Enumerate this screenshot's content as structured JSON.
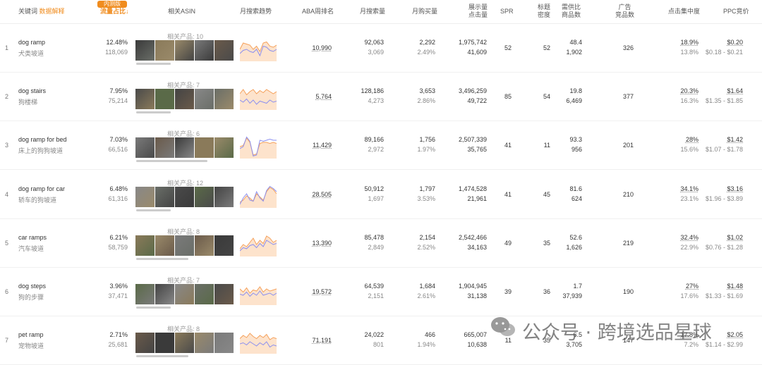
{
  "headers": {
    "keyword": "关键词",
    "explain": "数据解释",
    "traffic_share": "流量占比",
    "traffic_badge": "内测版",
    "related_asin": "相关ASIN",
    "monthly_trend": "月搜索趋势",
    "aba_rank": "ABA周排名",
    "monthly_search": "月搜索量",
    "monthly_purchase": "月购买量",
    "impressions_clicks": [
      "展示量",
      "点击量"
    ],
    "spr": "SPR",
    "title_density": [
      "标题",
      "密度"
    ],
    "supply_demand": [
      "需供比",
      "商品数"
    ],
    "ads": [
      "广告",
      "竞品数"
    ],
    "click_concentration": "点击集中度",
    "ppc": "PPC竞价"
  },
  "rows": [
    {
      "idx": "1",
      "keyword": "dog ramp",
      "keyword_cn": "犬类坡道",
      "share_pct": "12.48%",
      "share_num": "118,069",
      "related": "相关产品: 10",
      "bar_frac": 0.38,
      "aba": "10,990",
      "search": "92,063",
      "search_sub": "3,069",
      "purchase": "2,292",
      "purchase_rate": "2.49%",
      "impressions": "1,975,742",
      "clicks": "41,609",
      "spr": "52",
      "title_density": "52",
      "ratio": "48.4",
      "products": "1,902",
      "ads": "326",
      "click_conc": "18.9%",
      "click_conc_sub": "13.8%",
      "ppc": "$0.20",
      "ppc_range": "$0.18 - $0.21",
      "trend": {
        "orange": [
          0.5,
          0.2,
          0.25,
          0.3,
          0.5,
          0.35,
          0.6,
          0.2,
          0.15,
          0.35,
          0.4,
          0.3
        ],
        "blue": [
          0.7,
          0.55,
          0.5,
          0.6,
          0.65,
          0.5,
          0.8,
          0.35,
          0.4,
          0.55,
          0.6,
          0.5
        ]
      }
    },
    {
      "idx": "2",
      "keyword": "dog stairs",
      "keyword_cn": "狗楼梯",
      "share_pct": "7.95%",
      "share_num": "75,214",
      "related": "相关产品: 7",
      "bar_frac": 0.38,
      "aba": "5,764",
      "search": "128,186",
      "search_sub": "4,273",
      "purchase": "3,653",
      "purchase_rate": "2.86%",
      "impressions": "3,496,259",
      "clicks": "49,722",
      "spr": "85",
      "title_density": "54",
      "ratio": "19.8",
      "products": "6,469",
      "ads": "377",
      "click_conc": "20.3%",
      "click_conc_sub": "16.3%",
      "ppc": "$1.64",
      "ppc_range": "$1.35 - $1.85",
      "trend": {
        "orange": [
          0.3,
          0.1,
          0.35,
          0.2,
          0.1,
          0.3,
          0.15,
          0.25,
          0.1,
          0.2,
          0.3,
          0.2
        ],
        "blue": [
          0.6,
          0.7,
          0.55,
          0.75,
          0.6,
          0.8,
          0.65,
          0.7,
          0.75,
          0.6,
          0.7,
          0.65
        ]
      }
    },
    {
      "idx": "3",
      "keyword": "dog ramp for bed",
      "keyword_cn": "床上的狗狗坡道",
      "share_pct": "7.03%",
      "share_num": "66,516",
      "related": "相关产品: 6",
      "bar_frac": 0.78,
      "aba": "11,429",
      "search": "89,166",
      "search_sub": "2,972",
      "purchase": "1,756",
      "purchase_rate": "1.97%",
      "impressions": "2,507,339",
      "clicks": "35,765",
      "spr": "41",
      "title_density": "11",
      "ratio": "93.3",
      "products": "956",
      "ads": "201",
      "click_conc": "28%",
      "click_conc_sub": "15.6%",
      "ppc": "$1.42",
      "ppc_range": "$1.07 - $1.78",
      "trend": {
        "orange": [
          0.5,
          0.45,
          0.1,
          0.3,
          0.9,
          0.85,
          0.35,
          0.3,
          0.3,
          0.35,
          0.3,
          0.35
        ],
        "blue": [
          0.6,
          0.5,
          0.05,
          0.25,
          0.95,
          0.9,
          0.2,
          0.25,
          0.2,
          0.15,
          0.2,
          0.2
        ]
      }
    },
    {
      "idx": "4",
      "keyword": "dog ramp for car",
      "keyword_cn": "轿车的狗坡道",
      "share_pct": "6.48%",
      "share_num": "61,316",
      "related": "相关产品: 12",
      "bar_frac": 0.38,
      "aba": "28,505",
      "search": "50,912",
      "search_sub": "1,697",
      "purchase": "1,797",
      "purchase_rate": "3.53%",
      "impressions": "1,474,528",
      "clicks": "21,961",
      "spr": "41",
      "title_density": "45",
      "ratio": "81.6",
      "products": "624",
      "ads": "210",
      "click_conc": "34.1%",
      "click_conc_sub": "23.1%",
      "ppc": "$3.16",
      "ppc_range": "$1.96 - $3.89",
      "trend": {
        "orange": [
          0.8,
          0.7,
          0.5,
          0.6,
          0.75,
          0.4,
          0.55,
          0.7,
          0.3,
          0.1,
          0.2,
          0.4
        ],
        "blue": [
          0.9,
          0.6,
          0.4,
          0.7,
          0.75,
          0.3,
          0.6,
          0.75,
          0.25,
          0.05,
          0.15,
          0.3
        ]
      }
    },
    {
      "idx": "5",
      "keyword": "car ramps",
      "keyword_cn": "汽车坡道",
      "share_pct": "6.21%",
      "share_num": "58,759",
      "related": "相关产品: 8",
      "bar_frac": 0.57,
      "aba": "13,390",
      "search": "85,478",
      "search_sub": "2,849",
      "purchase": "2,154",
      "purchase_rate": "2.52%",
      "impressions": "2,542,466",
      "clicks": "34,163",
      "spr": "49",
      "title_density": "35",
      "ratio": "52.6",
      "products": "1,626",
      "ads": "219",
      "click_conc": "32.4%",
      "click_conc_sub": "22.9%",
      "ppc": "$1.02",
      "ppc_range": "$0.76 - $1.28",
      "trend": {
        "orange": [
          0.7,
          0.5,
          0.6,
          0.4,
          0.2,
          0.5,
          0.3,
          0.45,
          0.1,
          0.2,
          0.4,
          0.3
        ],
        "blue": [
          0.8,
          0.65,
          0.7,
          0.55,
          0.5,
          0.65,
          0.45,
          0.6,
          0.3,
          0.4,
          0.5,
          0.45
        ]
      }
    },
    {
      "idx": "6",
      "keyword": "dog steps",
      "keyword_cn": "狗的步骤",
      "share_pct": "3.96%",
      "share_num": "37,471",
      "related": "相关产品: 7",
      "bar_frac": 0.38,
      "aba": "19,572",
      "search": "64,539",
      "search_sub": "2,151",
      "purchase": "1,684",
      "purchase_rate": "2.61%",
      "impressions": "1,904,945",
      "clicks": "31,138",
      "spr": "39",
      "title_density": "36",
      "ratio": "1.7",
      "products": "37,939",
      "ads": "190",
      "click_conc": "27%",
      "click_conc_sub": "17.6%",
      "ppc": "$1.48",
      "ppc_range": "$1.33 - $1.69",
      "trend": {
        "orange": [
          0.3,
          0.45,
          0.25,
          0.5,
          0.35,
          0.4,
          0.2,
          0.45,
          0.3,
          0.4,
          0.35,
          0.3
        ],
        "blue": [
          0.55,
          0.6,
          0.45,
          0.65,
          0.5,
          0.6,
          0.4,
          0.6,
          0.55,
          0.5,
          0.6,
          0.5
        ]
      }
    },
    {
      "idx": "7",
      "keyword": "pet ramp",
      "keyword_cn": "宠物坡道",
      "share_pct": "2.71%",
      "share_num": "25,681",
      "related": "相关产品: 8",
      "bar_frac": 0.57,
      "aba": "71,191",
      "search": "24,022",
      "search_sub": "801",
      "purchase": "466",
      "purchase_rate": "1.94%",
      "impressions": "665,007",
      "clicks": "10,638",
      "spr": "11",
      "title_density": "35",
      "ratio": "6.5",
      "products": "3,705",
      "ads": "147",
      "click_conc": "17.8%",
      "click_conc_sub": "7.2%",
      "ppc": "$2.05",
      "ppc_range": "$1.14 - $2.99",
      "trend": {
        "orange": [
          0.35,
          0.2,
          0.3,
          0.1,
          0.25,
          0.35,
          0.2,
          0.3,
          0.15,
          0.4,
          0.3,
          0.35
        ],
        "blue": [
          0.6,
          0.55,
          0.65,
          0.5,
          0.6,
          0.7,
          0.55,
          0.65,
          0.5,
          0.75,
          0.65,
          0.7
        ]
      }
    }
  ],
  "thumb_colors": [
    "#3a3a3a",
    "#6a6e68",
    "#8a7a5a",
    "#4a4a4a",
    "#9a8a6a",
    "#5a6a48",
    "#7a7a7a",
    "#444",
    "#6a5a4a",
    "#888"
  ],
  "trend_colors": {
    "orange": "#f5a05a",
    "blue": "#8b8ff0",
    "fill": "#fde3cc"
  },
  "watermark": "公众号 · 跨境选品星球"
}
